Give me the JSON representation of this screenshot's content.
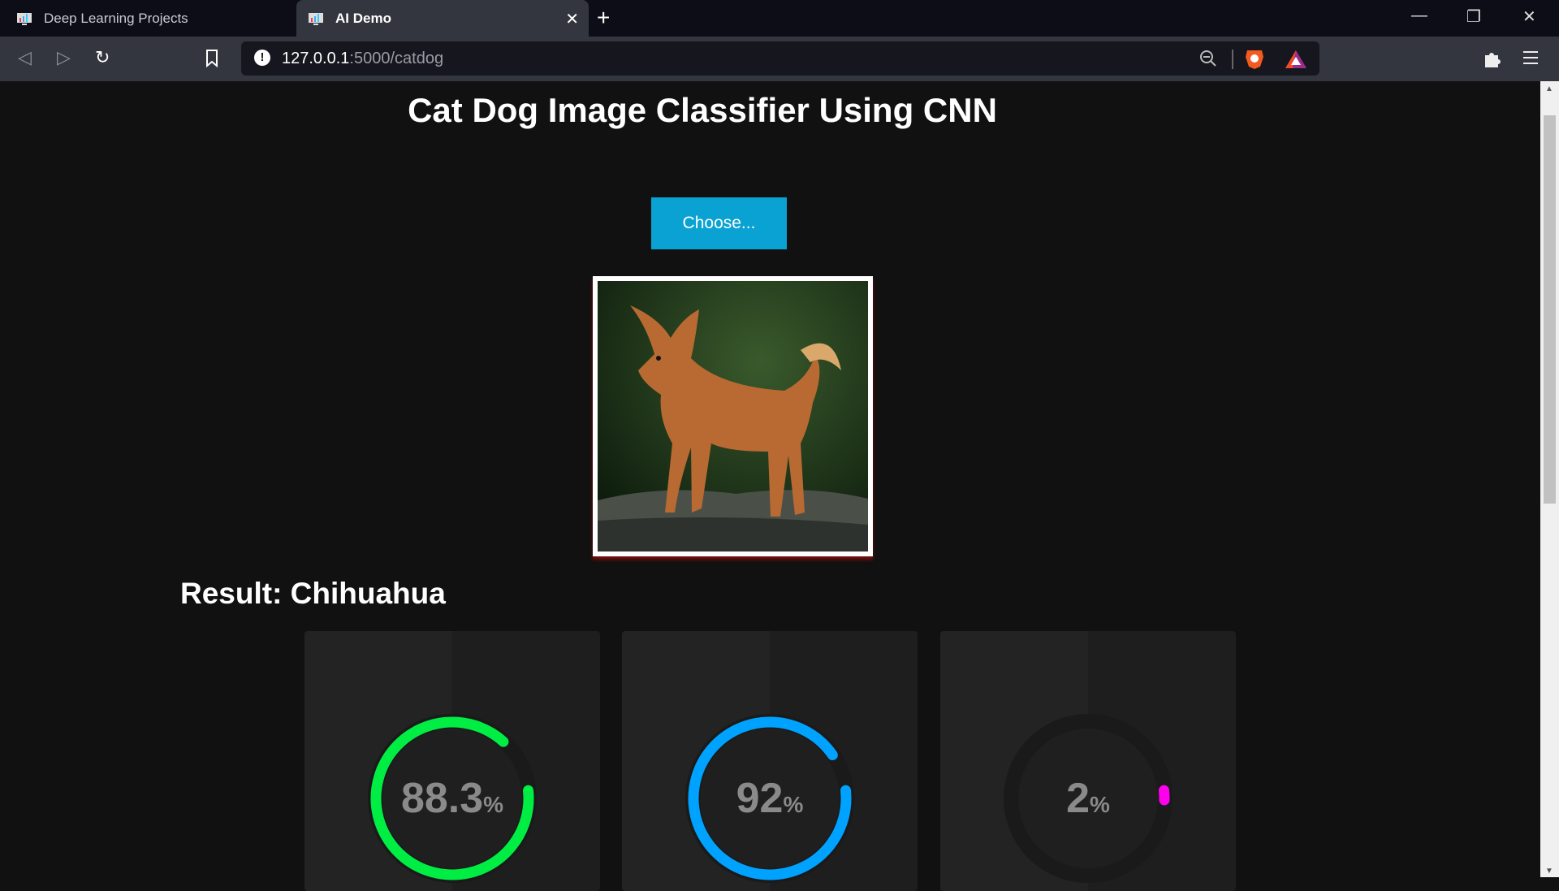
{
  "browser": {
    "tabs": [
      {
        "label": "Deep Learning Projects",
        "active": false
      },
      {
        "label": "AI Demo",
        "active": true
      }
    ],
    "url_host": "127.0.0.1",
    "url_rest": ":5000/catdog"
  },
  "page": {
    "title": "Cat Dog Image Classifier Using CNN",
    "choose_label": "Choose...",
    "result_label": "Result: Chihuahua",
    "gauges": [
      {
        "value": "88.3",
        "unit": "%",
        "percent": 88.3,
        "color": "#00ee44"
      },
      {
        "value": "92",
        "unit": "%",
        "percent": 92,
        "color": "#00a2ff"
      },
      {
        "value": "2",
        "unit": "%",
        "percent": 2,
        "color": "#ff00ee"
      }
    ]
  }
}
